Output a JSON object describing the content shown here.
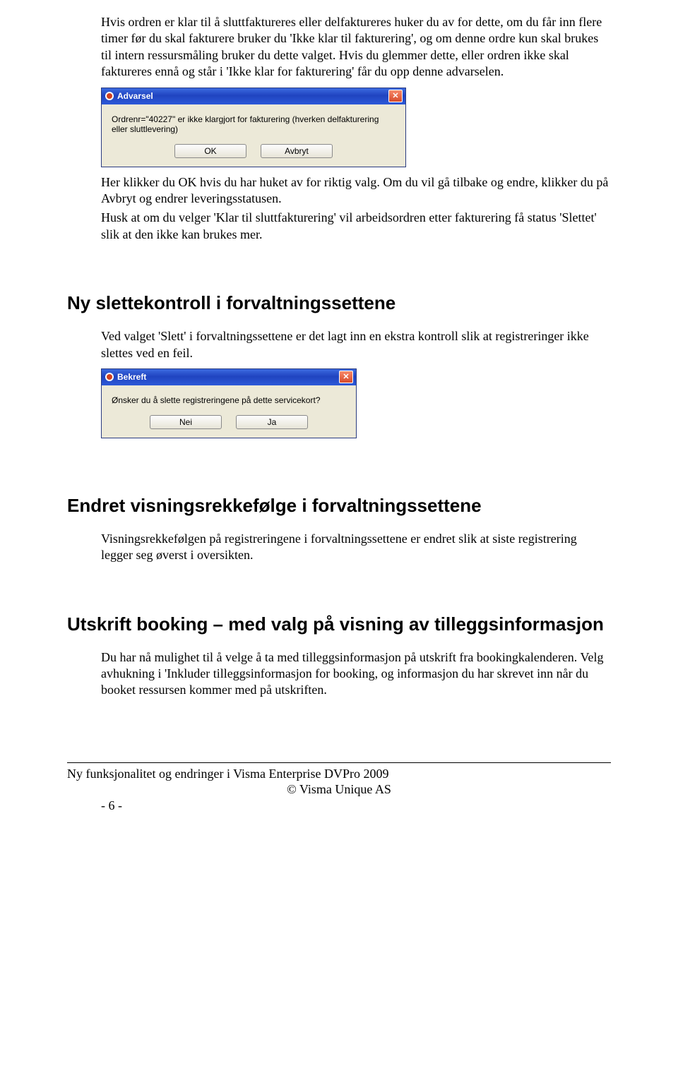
{
  "para1": "Hvis ordren er klar til å sluttfaktureres eller delfaktureres huker du av for dette, om du får inn flere timer før du skal fakturere bruker du 'Ikke klar til fakturering', og om denne ordre kun skal brukes til intern ressursmåling bruker du dette valget. Hvis du glemmer dette, eller ordren ikke skal faktureres ennå og står i 'Ikke klar for fakturering' får du opp denne advarselen.",
  "dialog1": {
    "title": "Advarsel",
    "body": "Ordrenr=\"40227\" er ikke klargjort for fakturering (hverken delfakturering eller sluttlevering)",
    "ok": "OK",
    "cancel": "Avbryt"
  },
  "para2": "Her klikker du OK hvis du har huket av for riktig valg. Om du vil gå tilbake og endre, klikker du på Avbryt og endrer leveringsstatusen.",
  "para3": "Husk at om du velger 'Klar til sluttfakturering' vil arbeidsordren etter fakturering få status 'Slettet' slik at den ikke kan brukes mer.",
  "h2_1": "Ny slettekontroll i forvaltningssettene",
  "para4": "Ved valget 'Slett' i forvaltningssettene er det lagt inn en ekstra kontroll slik at registreringer ikke slettes ved en feil.",
  "dialog2": {
    "title": "Bekreft",
    "body": "Ønsker du å slette registreringene på dette servicekort?",
    "no": "Nei",
    "yes": "Ja"
  },
  "h2_2": "Endret visningsrekkefølge i forvaltningssettene",
  "para5": "Visningsrekkefølgen på registreringene i forvaltningssettene er endret slik at siste registrering legger seg øverst i oversikten.",
  "h2_3": "Utskrift booking – med valg på visning av tilleggsinformasjon",
  "para6": "Du har nå mulighet til å velge å ta med tilleggsinformasjon på utskrift fra bookingkalenderen. Velg avhukning i 'Inkluder tilleggsinformasjon for booking, og informasjon du har skrevet inn når du booket ressursen kommer med på utskriften.",
  "footer": {
    "line1": "Ny funksjonalitet og endringer i Visma Enterprise DVPro 2009",
    "line2": "© Visma Unique AS",
    "pagenum": "- 6 -"
  }
}
